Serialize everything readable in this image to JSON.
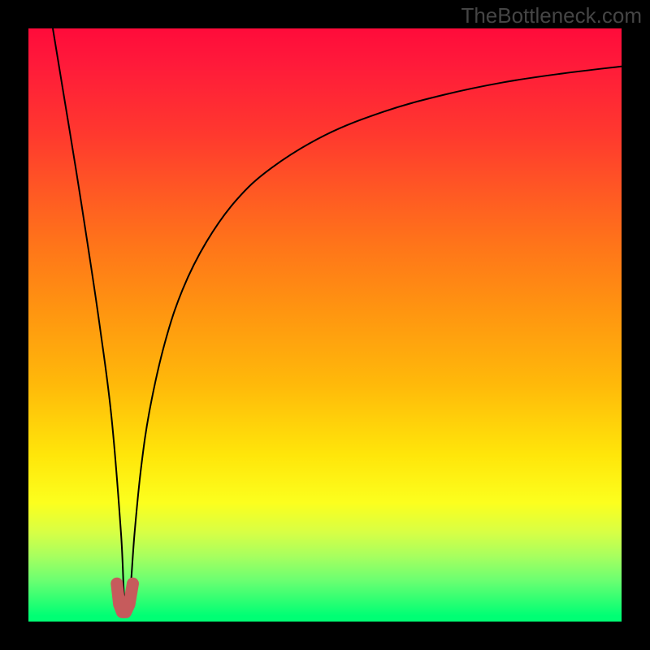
{
  "watermark": "TheBottleneck.com",
  "chart_data": {
    "type": "line",
    "title": "",
    "xlabel": "",
    "ylabel": "",
    "xlim": [
      0,
      1
    ],
    "ylim": [
      0,
      1
    ],
    "series": [
      {
        "name": "bottleneck-curve",
        "x": [
          0.0411,
          0.06,
          0.08,
          0.1,
          0.12,
          0.14,
          0.156,
          0.162,
          0.17,
          0.179,
          0.19,
          0.205,
          0.23,
          0.26,
          0.3,
          0.35,
          0.41,
          0.5,
          0.6,
          0.7,
          0.8,
          0.9,
          1.0
        ],
        "y": [
          1.0,
          0.885,
          0.763,
          0.635,
          0.5,
          0.345,
          0.15,
          0.035,
          0.035,
          0.15,
          0.26,
          0.36,
          0.47,
          0.56,
          0.64,
          0.71,
          0.765,
          0.82,
          0.86,
          0.888,
          0.909,
          0.924,
          0.936
        ]
      }
    ],
    "marker": {
      "name": "highlight-U",
      "x": [
        0.149,
        0.153,
        0.158,
        0.164,
        0.17,
        0.176
      ],
      "y": [
        0.064,
        0.029,
        0.016,
        0.016,
        0.029,
        0.064
      ]
    },
    "background_gradient": {
      "stops": [
        {
          "pos": 0.0,
          "color": "#ff0b3a"
        },
        {
          "pos": 0.06,
          "color": "#ff1a3a"
        },
        {
          "pos": 0.18,
          "color": "#ff392e"
        },
        {
          "pos": 0.28,
          "color": "#ff5a23"
        },
        {
          "pos": 0.37,
          "color": "#ff7619"
        },
        {
          "pos": 0.48,
          "color": "#ff9610"
        },
        {
          "pos": 0.6,
          "color": "#ffb90a"
        },
        {
          "pos": 0.72,
          "color": "#ffe60a"
        },
        {
          "pos": 0.8,
          "color": "#fcff1e"
        },
        {
          "pos": 0.85,
          "color": "#d7ff45"
        },
        {
          "pos": 0.89,
          "color": "#a7ff5f"
        },
        {
          "pos": 0.93,
          "color": "#6cff71"
        },
        {
          "pos": 0.99,
          "color": "#00ff74"
        },
        {
          "pos": 1.0,
          "color": "#00ff74"
        }
      ]
    }
  }
}
